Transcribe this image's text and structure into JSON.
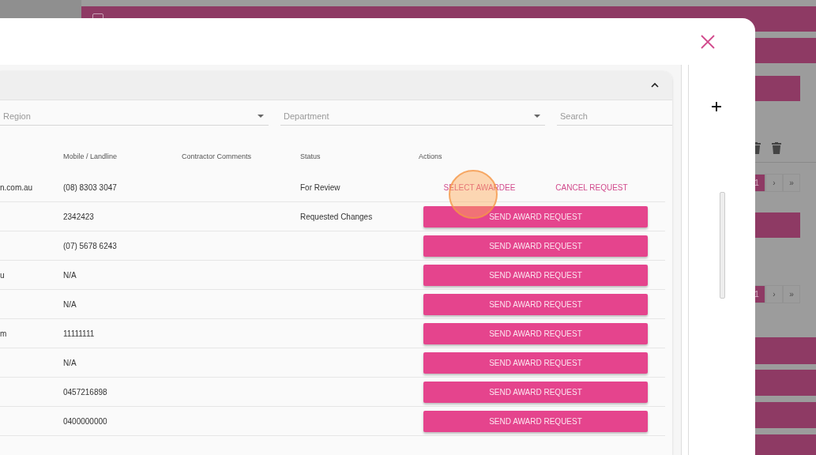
{
  "background_page": {
    "paginations": [
      {
        "pages": [
          {
            "label": "1",
            "selected": true
          },
          {
            "label": "›",
            "selected": false
          },
          {
            "label": "»",
            "selected": false
          }
        ]
      },
      {
        "pages": [
          {
            "label": "1",
            "selected": true
          },
          {
            "label": "›",
            "selected": false
          },
          {
            "label": "»",
            "selected": false
          }
        ]
      }
    ]
  },
  "modal": {
    "panel": {
      "expanded": true
    },
    "filters": [
      {
        "kind": "select",
        "placeholder": "Region"
      },
      {
        "kind": "select",
        "placeholder": "Department"
      },
      {
        "kind": "search",
        "placeholder": "Search"
      }
    ],
    "table": {
      "columns": [
        "Mobile / Landline",
        "Contractor Comments",
        "Status",
        "Actions"
      ],
      "rows": [
        {
          "column_1": "n.com.au",
          "mobile": "(08) 8303 3047",
          "status": "For Review",
          "actions": [
            {
              "kind": "link",
              "label": "SELECT AWARDEE"
            },
            {
              "kind": "link",
              "label": "CANCEL REQUEST"
            }
          ]
        },
        {
          "mobile": "2342423",
          "status": "Requested Changes",
          "actions": [
            {
              "kind": "button",
              "label": "SEND AWARD REQUEST"
            }
          ]
        },
        {
          "mobile": "(07) 5678 6243",
          "actions": [
            {
              "kind": "button",
              "label": "SEND AWARD REQUEST"
            }
          ]
        },
        {
          "column_1": "u",
          "mobile": "N/A",
          "actions": [
            {
              "kind": "button",
              "label": "SEND AWARD REQUEST"
            }
          ]
        },
        {
          "mobile": "N/A",
          "actions": [
            {
              "kind": "button",
              "label": "SEND AWARD REQUEST"
            }
          ]
        },
        {
          "column_1": "m",
          "mobile": "11111111",
          "actions": [
            {
              "kind": "button",
              "label": "SEND AWARD REQUEST"
            }
          ]
        },
        {
          "mobile": "N/A",
          "actions": [
            {
              "kind": "button",
              "label": "SEND AWARD REQUEST"
            }
          ]
        },
        {
          "mobile": "0457216898",
          "actions": [
            {
              "kind": "button",
              "label": "SEND AWARD REQUEST"
            }
          ]
        },
        {
          "mobile": "0400000000",
          "actions": [
            {
              "kind": "button",
              "label": "SEND AWARD REQUEST"
            }
          ]
        }
      ]
    }
  }
}
